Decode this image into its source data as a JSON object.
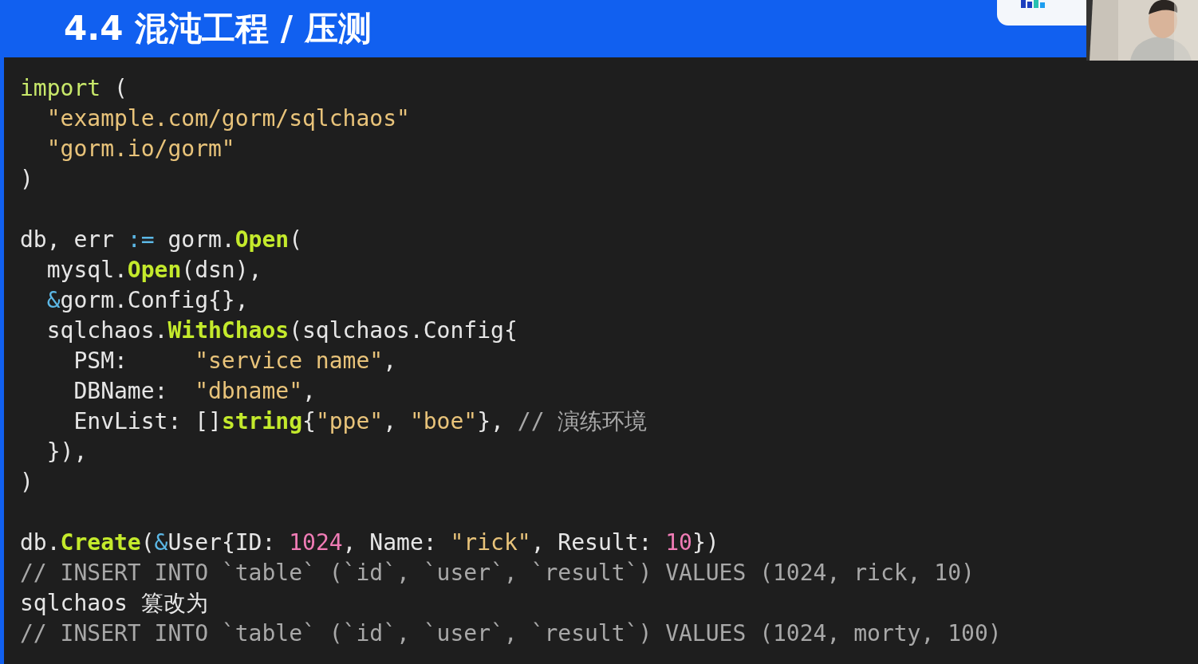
{
  "header": {
    "title": "4.4 混沌工程 / 压测",
    "logo": {
      "kind": "logo"
    }
  },
  "code": [
    {
      "kind": "code",
      "tokens": [
        {
          "kind": "keyword",
          "text": "import"
        },
        {
          "kind": "plain",
          "text": " ("
        }
      ]
    },
    {
      "kind": "code",
      "tokens": [
        {
          "kind": "string",
          "text": "  \"example.com/gorm/sqlchaos\""
        }
      ]
    },
    {
      "kind": "code",
      "tokens": [
        {
          "kind": "string",
          "text": "  \"gorm.io/gorm\""
        }
      ]
    },
    {
      "kind": "code",
      "tokens": [
        {
          "kind": "plain",
          "text": ")"
        }
      ]
    },
    {
      "kind": "blank"
    },
    {
      "kind": "code",
      "tokens": [
        {
          "kind": "plain",
          "text": "db, err "
        },
        {
          "kind": "op",
          "text": ":="
        },
        {
          "kind": "plain",
          "text": " gorm."
        },
        {
          "kind": "func",
          "text": "Open"
        },
        {
          "kind": "plain",
          "text": "("
        }
      ]
    },
    {
      "kind": "code",
      "tokens": [
        {
          "kind": "plain",
          "text": "  mysql."
        },
        {
          "kind": "func",
          "text": "Open"
        },
        {
          "kind": "plain",
          "text": "(dsn),"
        }
      ]
    },
    {
      "kind": "code",
      "tokens": [
        {
          "kind": "op",
          "text": "  &"
        },
        {
          "kind": "plain",
          "text": "gorm.Config{},"
        }
      ]
    },
    {
      "kind": "code",
      "tokens": [
        {
          "kind": "plain",
          "text": "  sqlchaos."
        },
        {
          "kind": "func",
          "text": "WithChaos"
        },
        {
          "kind": "plain",
          "text": "(sqlchaos.Config{"
        }
      ]
    },
    {
      "kind": "code",
      "tokens": [
        {
          "kind": "plain",
          "text": "    PSM:     "
        },
        {
          "kind": "string",
          "text": "\"service name\""
        },
        {
          "kind": "plain",
          "text": ","
        }
      ]
    },
    {
      "kind": "code",
      "tokens": [
        {
          "kind": "plain",
          "text": "    DBName:  "
        },
        {
          "kind": "string",
          "text": "\"dbname\""
        },
        {
          "kind": "plain",
          "text": ","
        }
      ]
    },
    {
      "kind": "code",
      "tokens": [
        {
          "kind": "plain",
          "text": "    EnvList: []"
        },
        {
          "kind": "func",
          "text": "string"
        },
        {
          "kind": "plain",
          "text": "{"
        },
        {
          "kind": "string",
          "text": "\"ppe\""
        },
        {
          "kind": "plain",
          "text": ", "
        },
        {
          "kind": "string",
          "text": "\"boe\""
        },
        {
          "kind": "plain",
          "text": "}, "
        },
        {
          "kind": "comment",
          "text": "// 演练环境"
        }
      ]
    },
    {
      "kind": "code",
      "tokens": [
        {
          "kind": "plain",
          "text": "  }),"
        }
      ]
    },
    {
      "kind": "code",
      "tokens": [
        {
          "kind": "plain",
          "text": ")"
        }
      ]
    },
    {
      "kind": "blank"
    },
    {
      "kind": "code",
      "tokens": [
        {
          "kind": "plain",
          "text": "db."
        },
        {
          "kind": "func",
          "text": "Create"
        },
        {
          "kind": "plain",
          "text": "("
        },
        {
          "kind": "op",
          "text": "&"
        },
        {
          "kind": "plain",
          "text": "User{ID: "
        },
        {
          "kind": "number",
          "text": "1024"
        },
        {
          "kind": "plain",
          "text": ", Name: "
        },
        {
          "kind": "string",
          "text": "\"rick\""
        },
        {
          "kind": "plain",
          "text": ", Result: "
        },
        {
          "kind": "number",
          "text": "10"
        },
        {
          "kind": "plain",
          "text": "})"
        }
      ]
    },
    {
      "kind": "code",
      "tokens": [
        {
          "kind": "comment",
          "text": "// INSERT INTO `table` (`id`, `user`, `result`) VALUES (1024, rick, 10)"
        }
      ]
    },
    {
      "kind": "code",
      "tokens": [
        {
          "kind": "plain",
          "text": "sqlchaos 篡改为"
        }
      ]
    },
    {
      "kind": "code",
      "tokens": [
        {
          "kind": "comment",
          "text": "// INSERT INTO `table` (`id`, `user`, `result`) VALUES (1024, morty, 100)"
        }
      ]
    }
  ]
}
